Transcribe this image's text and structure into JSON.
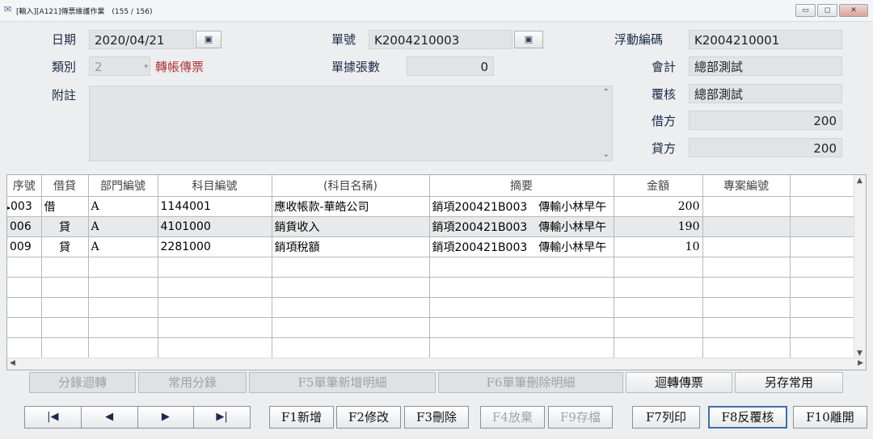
{
  "window": {
    "title": "[輸入][A121]傳票維護作業　(155 / 156)",
    "controls": [
      "▭",
      "◻",
      "✕"
    ]
  },
  "form": {
    "date_label": "日期",
    "date_value": "2020/04/21",
    "category_label": "類別",
    "category_value": "2",
    "category_text": "轉帳傳票",
    "memo_label": "附註",
    "memo_value": "",
    "voucher_no_label": "單號",
    "voucher_no_value": "K2004210003",
    "doc_count_label": "單據張數",
    "doc_count_value": "0",
    "float_code_label": "浮動編碼",
    "float_code_value": "K2004210001",
    "accountant_label": "會計",
    "accountant_value": "總部測試",
    "reviewer_label": "覆核",
    "reviewer_value": "總部測試",
    "debit_label": "借方",
    "debit_value": "200",
    "credit_label": "貸方",
    "credit_value": "200"
  },
  "grid": {
    "columns": [
      "序號",
      "借貸",
      "部門編號",
      "科目編號",
      "(科目名稱)",
      "摘要",
      "金額",
      "專案編號"
    ],
    "rows": [
      {
        "seq": "003",
        "dc": "借",
        "dept": "A",
        "acct": "1144001",
        "acct_name": "應收帳款-華皓公司",
        "summary": "銷項200421B003　傳輸小林早午",
        "amount": "200",
        "project": ""
      },
      {
        "seq": "006",
        "dc": "貸",
        "dept": "A",
        "acct": "4101000",
        "acct_name": "銷貨收入",
        "summary": "銷項200421B003　傳輸小林早午",
        "amount": "190",
        "project": ""
      },
      {
        "seq": "009",
        "dc": "貸",
        "dept": "A",
        "acct": "2281000",
        "acct_name": "銷項稅額",
        "summary": "銷項200421B003　傳輸小林早午",
        "amount": "10",
        "project": ""
      }
    ],
    "empty_rows": 5
  },
  "toolbar": {
    "reverse_entry": "分錄迴轉",
    "common_entry": "常用分錄",
    "add_detail": "F5單筆新增明細",
    "delete_detail": "F6單筆刪除明細",
    "reverse_voucher": "迴轉傳票",
    "save_common": "另存常用"
  },
  "nav": {
    "first": "|◀",
    "prev": "◀",
    "next": "▶",
    "last": "▶|"
  },
  "fkeys": {
    "f1": "F1新增",
    "f2": "F2修改",
    "f3": "F3刪除",
    "f4": "F4放棄",
    "f9": "F9存檔",
    "f7": "F7列印",
    "f8": "F8反覆核",
    "f10": "F10離開"
  }
}
